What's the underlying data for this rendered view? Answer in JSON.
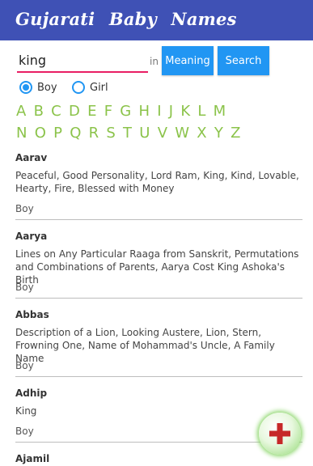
{
  "header": {
    "title": "Gujarati Baby Names"
  },
  "search": {
    "value": "king",
    "in_label": "in",
    "meaning_button": "Meaning",
    "search_button": "Search"
  },
  "gender": {
    "options": [
      "Boy",
      "Girl"
    ],
    "selected": "Boy"
  },
  "alphabet": {
    "row1": [
      "A",
      "B",
      "C",
      "D",
      "E",
      "F",
      "G",
      "H",
      "I",
      "J",
      "K",
      "L",
      "M"
    ],
    "row2": [
      "N",
      "O",
      "P",
      "Q",
      "R",
      "S",
      "T",
      "U",
      "V",
      "W",
      "X",
      "Y",
      "Z"
    ]
  },
  "names": [
    {
      "name": "Aarav",
      "meaning": "Peaceful, Good Personality, Lord Ram, King, Kind, Lovable, Hearty, Fire, Blessed with Money",
      "gender": "Boy"
    },
    {
      "name": "Aarya",
      "meaning": "Lines on Any Particular Raaga from Sanskrit, Permutations and Combinations of Parents, Aarya Cost King Ashoka's Birth",
      "gender": "Boy"
    },
    {
      "name": "Abbas",
      "meaning": "Description of a Lion, Looking Austere, Lion, Stern, Frowning One, Name of Mohammad's Uncle, A Family Name",
      "gender": "Boy"
    },
    {
      "name": "Adhip",
      "meaning": "King",
      "gender": "Boy"
    },
    {
      "name": "Ajamil",
      "meaning": "",
      "gender": ""
    }
  ],
  "colors": {
    "topbar": "#3f51b5",
    "button": "#2196f3",
    "letters": "#8bc34a",
    "fab_plus": "#c62828"
  },
  "fab": {
    "icon": "plus-icon"
  }
}
